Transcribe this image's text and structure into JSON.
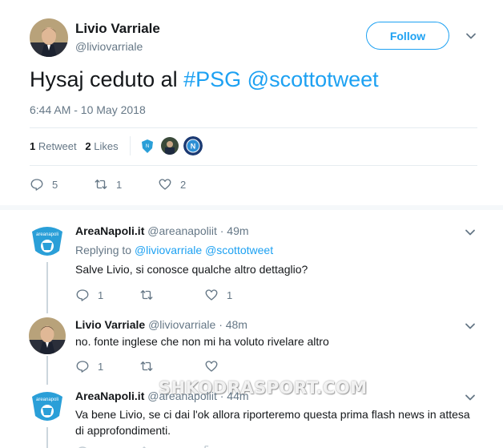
{
  "main_tweet": {
    "author_name": "Livio Varriale",
    "author_handle": "@liviovarriale",
    "follow_label": "Follow",
    "text_plain": "Hysaj ceduto al ",
    "hashtag": "#PSG",
    "mention": "@scottotweet",
    "timestamp": "6:44 AM - 10 May 2018",
    "retweet_count": "1",
    "retweet_label": "Retweet",
    "like_count": "2",
    "like_label": "Likes",
    "reply_count": "5",
    "retweet_action_count": "1",
    "like_action_count": "2"
  },
  "replies": [
    {
      "author_name": "AreaNapoli.it",
      "author_handle": "@areanapoliit",
      "time": "· 49m",
      "replying_label": "Replying to",
      "replying_to_1": "@liviovarriale",
      "replying_to_2": "@scottotweet",
      "text": "Salve Livio, si conosce qualche altro dettaglio?",
      "reply_count": "1",
      "retweet_count": "",
      "like_count": "1"
    },
    {
      "author_name": "Livio Varriale",
      "author_handle": "@liviovarriale",
      "time": "· 48m",
      "text": "no. fonte inglese che non mi ha voluto rivelare altro",
      "reply_count": "1",
      "retweet_count": "",
      "like_count": ""
    },
    {
      "author_name": "AreaNapoli.it",
      "author_handle": "@areanapoliit",
      "time": "· 44m",
      "text_line1": "Va bene Livio, se ci dai l'ok allora riporteremo questa prima flash news in attesa",
      "text_line2": "di approfondimenti."
    }
  ],
  "watermark": "SHKODRASPORT.COM",
  "colors": {
    "accent": "#1da1f2",
    "muted": "#657786",
    "text": "#14171a",
    "divider": "#e6ecf0"
  }
}
